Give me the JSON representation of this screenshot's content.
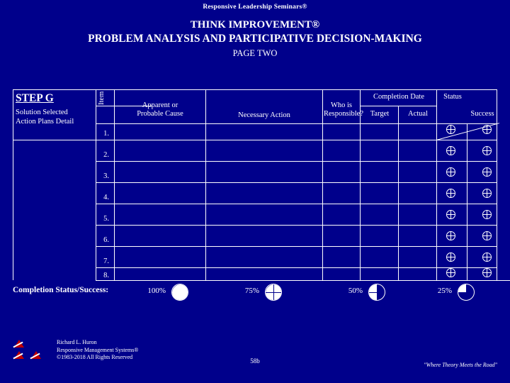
{
  "header": {
    "subtitle": "Responsive Leadership Seminars®",
    "line1": "THINK IMPROVEMENT®",
    "line2": "PROBLEM ANALYSIS AND PARTICIPATIVE DECISION-MAKING",
    "line3": "PAGE TWO"
  },
  "table": {
    "step_label": "STEP G",
    "step_sub": "Solution Selected\nAction Plans Detail",
    "item_label": "Item",
    "col_cause": "Apparent or\nProbable Cause",
    "col_action": "Necessary Action",
    "col_responsible": "Who is\nResponsible?",
    "col_completion_date": "Completion Date",
    "col_target": "Target",
    "col_actual": "Actual",
    "col_status": "Status",
    "col_success": "Success",
    "rows": [
      "1.",
      "2.",
      "3.",
      "4.",
      "5.",
      "6.",
      "7.",
      "8."
    ]
  },
  "status": {
    "label": "Completion Status/Success:",
    "items": [
      {
        "pct": "100%",
        "value": 100
      },
      {
        "pct": "75%",
        "value": 75
      },
      {
        "pct": "50%",
        "value": 50
      },
      {
        "pct": "25%",
        "value": 25
      }
    ]
  },
  "footer": {
    "author": "Richard L. Huron",
    "company": "Responsive Management Systems®",
    "copyright": "©1983-2018 All Rights Reserved",
    "page_number": "58b",
    "tagline": "\"Where Theory Meets the Road\""
  },
  "colors": {
    "background": "#00008B",
    "foreground": "#FFFFFF",
    "logo_accent": "#C00000"
  }
}
